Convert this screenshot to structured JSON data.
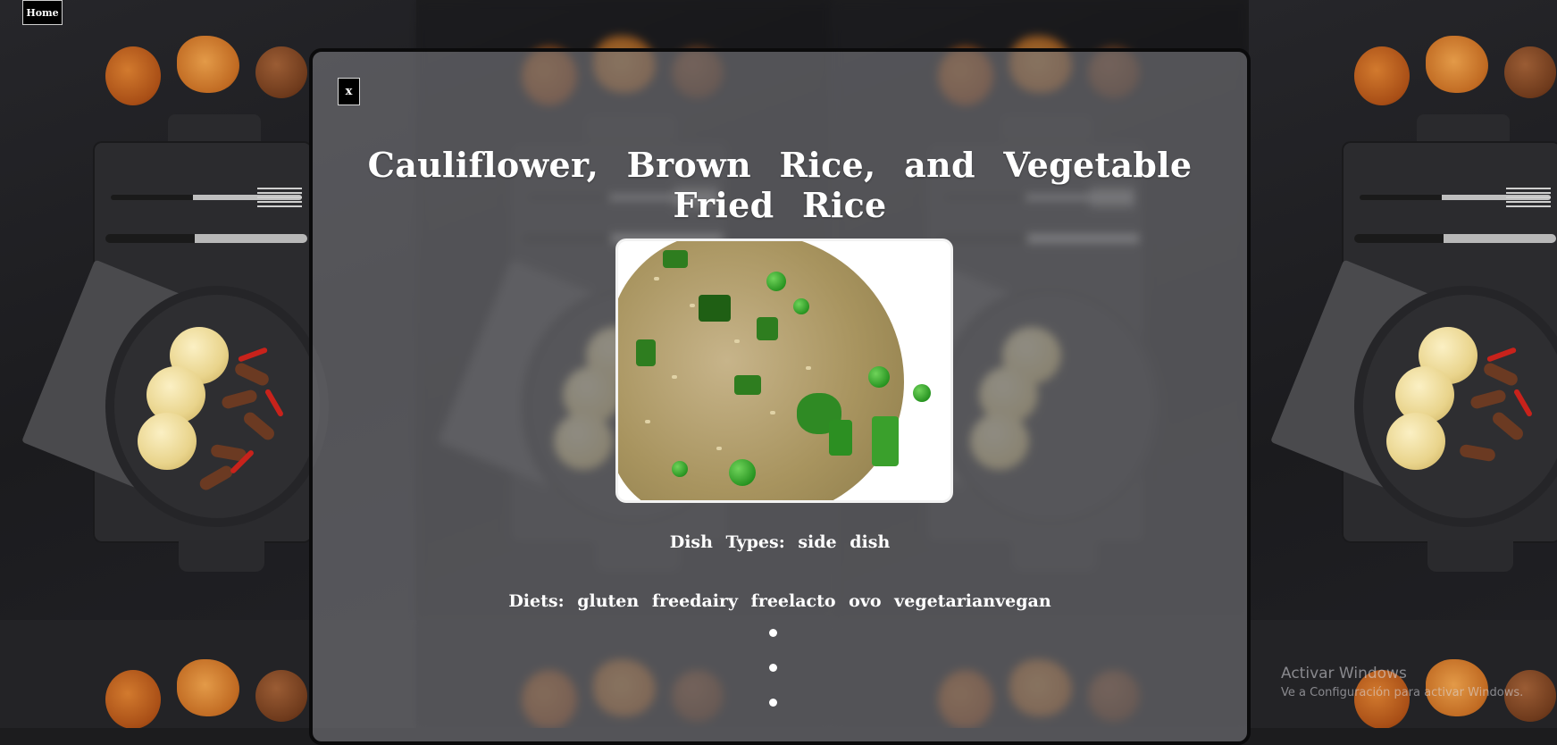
{
  "nav": {
    "home_label": "Home"
  },
  "modal": {
    "close_label": "x",
    "title": "Cauliflower, Brown Rice, and Vegetable Fried Rice",
    "image_alt": "Cauliflower, Brown Rice, and Vegetable Fried Rice",
    "dish_types_text": "Dish Types: side dish",
    "diets_text": "Diets: gluten freedairy freelacto ovo vegetarianvegan"
  },
  "os_watermark": {
    "title": "Activar Windows",
    "subtitle": "Ve a Configuración para activar Windows."
  },
  "colors": {
    "modal_overlay": "#78787d",
    "text": "#ffffff",
    "button_bg": "#000000"
  }
}
